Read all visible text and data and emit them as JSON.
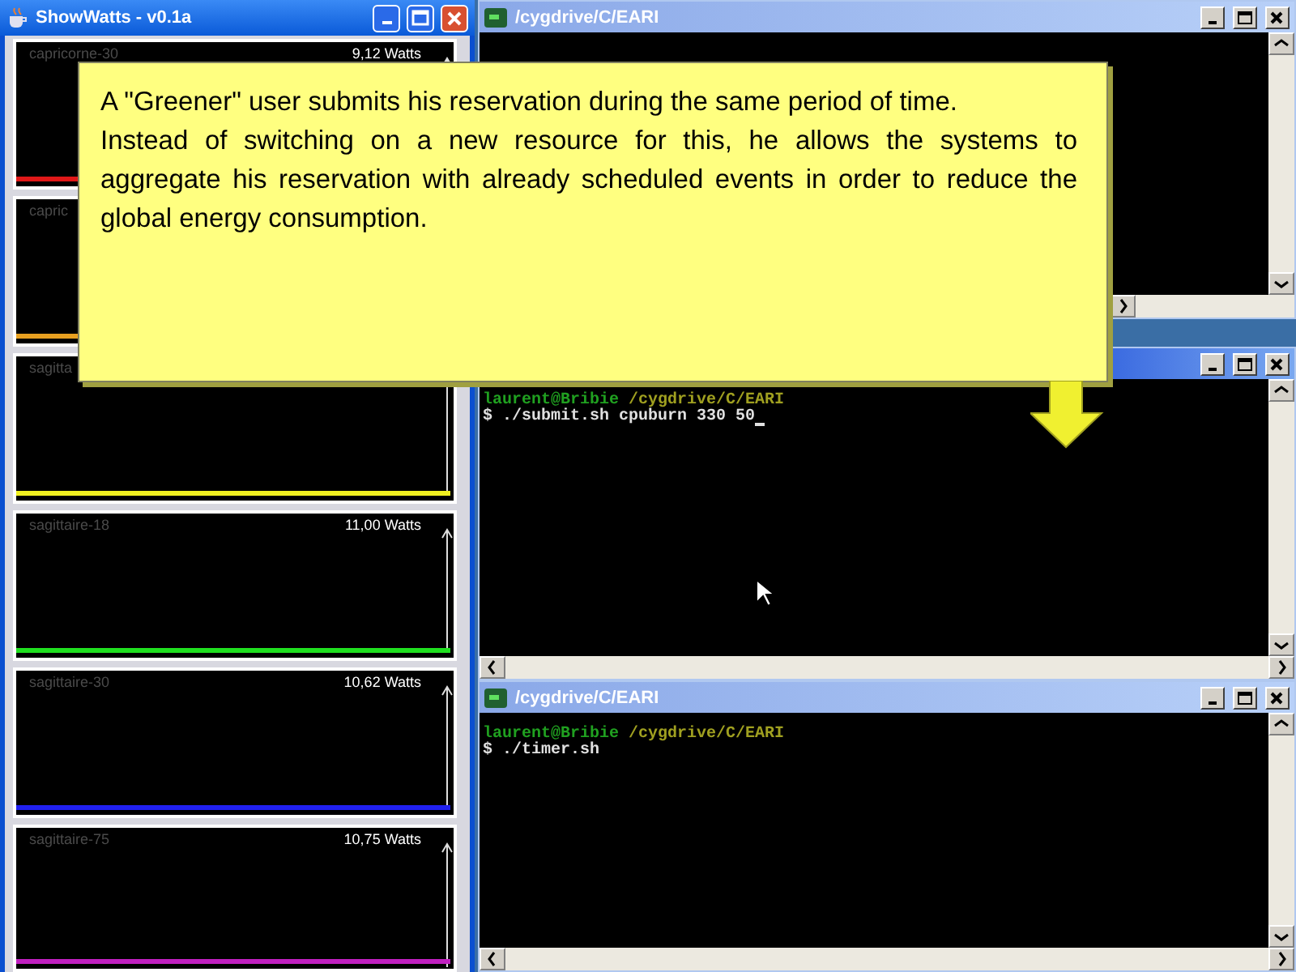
{
  "meter_window": {
    "title": "ShowWatts - v0.1a",
    "meters": [
      {
        "host": "capricorne-30",
        "reading": "9,12 Watts",
        "color": "#e01818"
      },
      {
        "host": "capric",
        "color": "#e8a020"
      },
      {
        "host": "sagitta",
        "color": "#f0f020"
      },
      {
        "host": "sagittaire-18",
        "reading": "11,00 Watts",
        "color": "#20e020"
      },
      {
        "host": "sagittaire-30",
        "reading": "10,62 Watts",
        "color": "#2020f0"
      },
      {
        "host": "sagittaire-75",
        "reading": "10,75 Watts",
        "color": "#c020c0"
      }
    ]
  },
  "terminals": [
    {
      "title": "/cygdrive/C/EARI"
    },
    {
      "lines": [
        {
          "user": "laurent@Bribie",
          "path": "/cygdrive/C/EARI"
        },
        {
          "command": "$ ./submit.sh cpuburn 330 50",
          "cursor": true
        }
      ]
    },
    {
      "title": "/cygdrive/C/EARI",
      "lines": [
        {
          "user": "laurent@Bribie",
          "path": "/cygdrive/C/EARI"
        },
        {
          "command": "$ ./timer.sh",
          "cursor": false
        }
      ]
    }
  ],
  "callout": {
    "paragraphs": [
      "A \"Greener\" user submits his reservation during the same period of time.",
      "Instead of switching on a new resource for this, he allows the systems to aggregate his reservation with already scheduled events in order to reduce the global energy consumption."
    ]
  }
}
